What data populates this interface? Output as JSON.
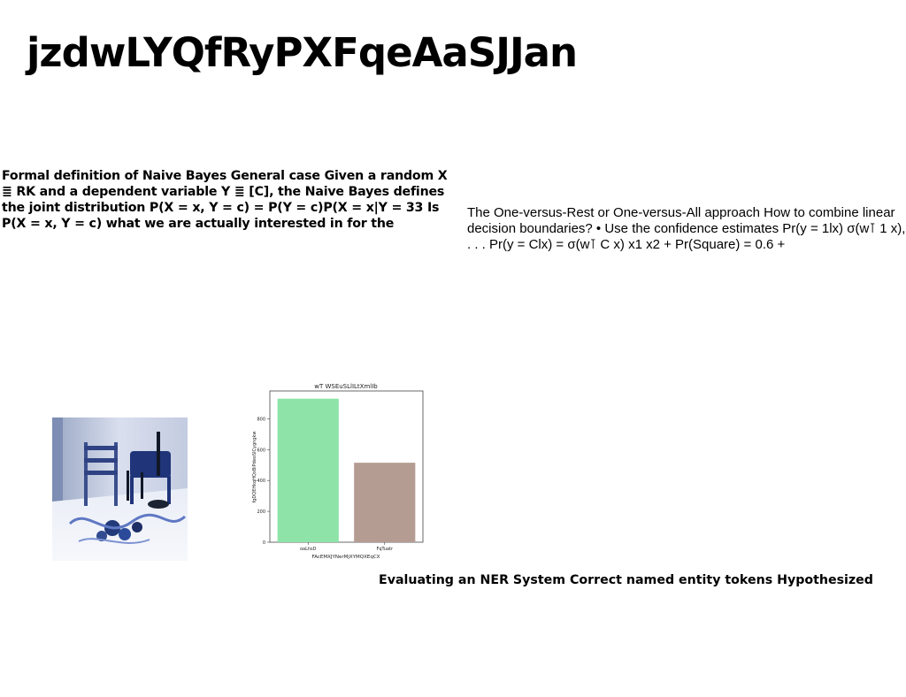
{
  "page": {
    "title": "jzdwLYQfRyPXFqeAaSJJan"
  },
  "blocks": {
    "left_paragraph": "Formal definition of Naive Bayes General case Given a random X ≣ RK and a dependent variable Y ≣ [C], the Naive Bayes defines the joint distribution P(X = x, Y = c) = P(Y = c)P(X = x|Y = 33 Is P(X = x, Y = c) what we are actually interested in for the",
    "right_paragraph": "The One-versus-Rest or One-versus-All approach How to combine linear decision boundaries? • Use the confidence estimates Pr(y = 1lx) σ(w⊺ 1 x), . . . Pr(y = Clx) = σ(w⊺ C x) x1 x2 + Pr(Square) = 0.6 +",
    "ner_caption": "Evaluating an NER System Correct named entity tokens Hypothesized"
  },
  "photo": {
    "icon": "still-life-photo-icon"
  },
  "chart_data": {
    "type": "bar",
    "title": "wT WSEuSLlILtXmlIb",
    "xlabel": "FAcEMXJYNerMjXYMQXEqCX",
    "ylabel": "fgDQEHkqHQxBiPdeoSlCygngkw",
    "categories": [
      "oaLhsD",
      "FqTuatr"
    ],
    "values": [
      930,
      515
    ],
    "ylim": [
      0,
      980
    ],
    "yticks": [
      0,
      200,
      400,
      600,
      800
    ],
    "colors": [
      "#8ee4a8",
      "#b59c93"
    ],
    "grid": false
  }
}
